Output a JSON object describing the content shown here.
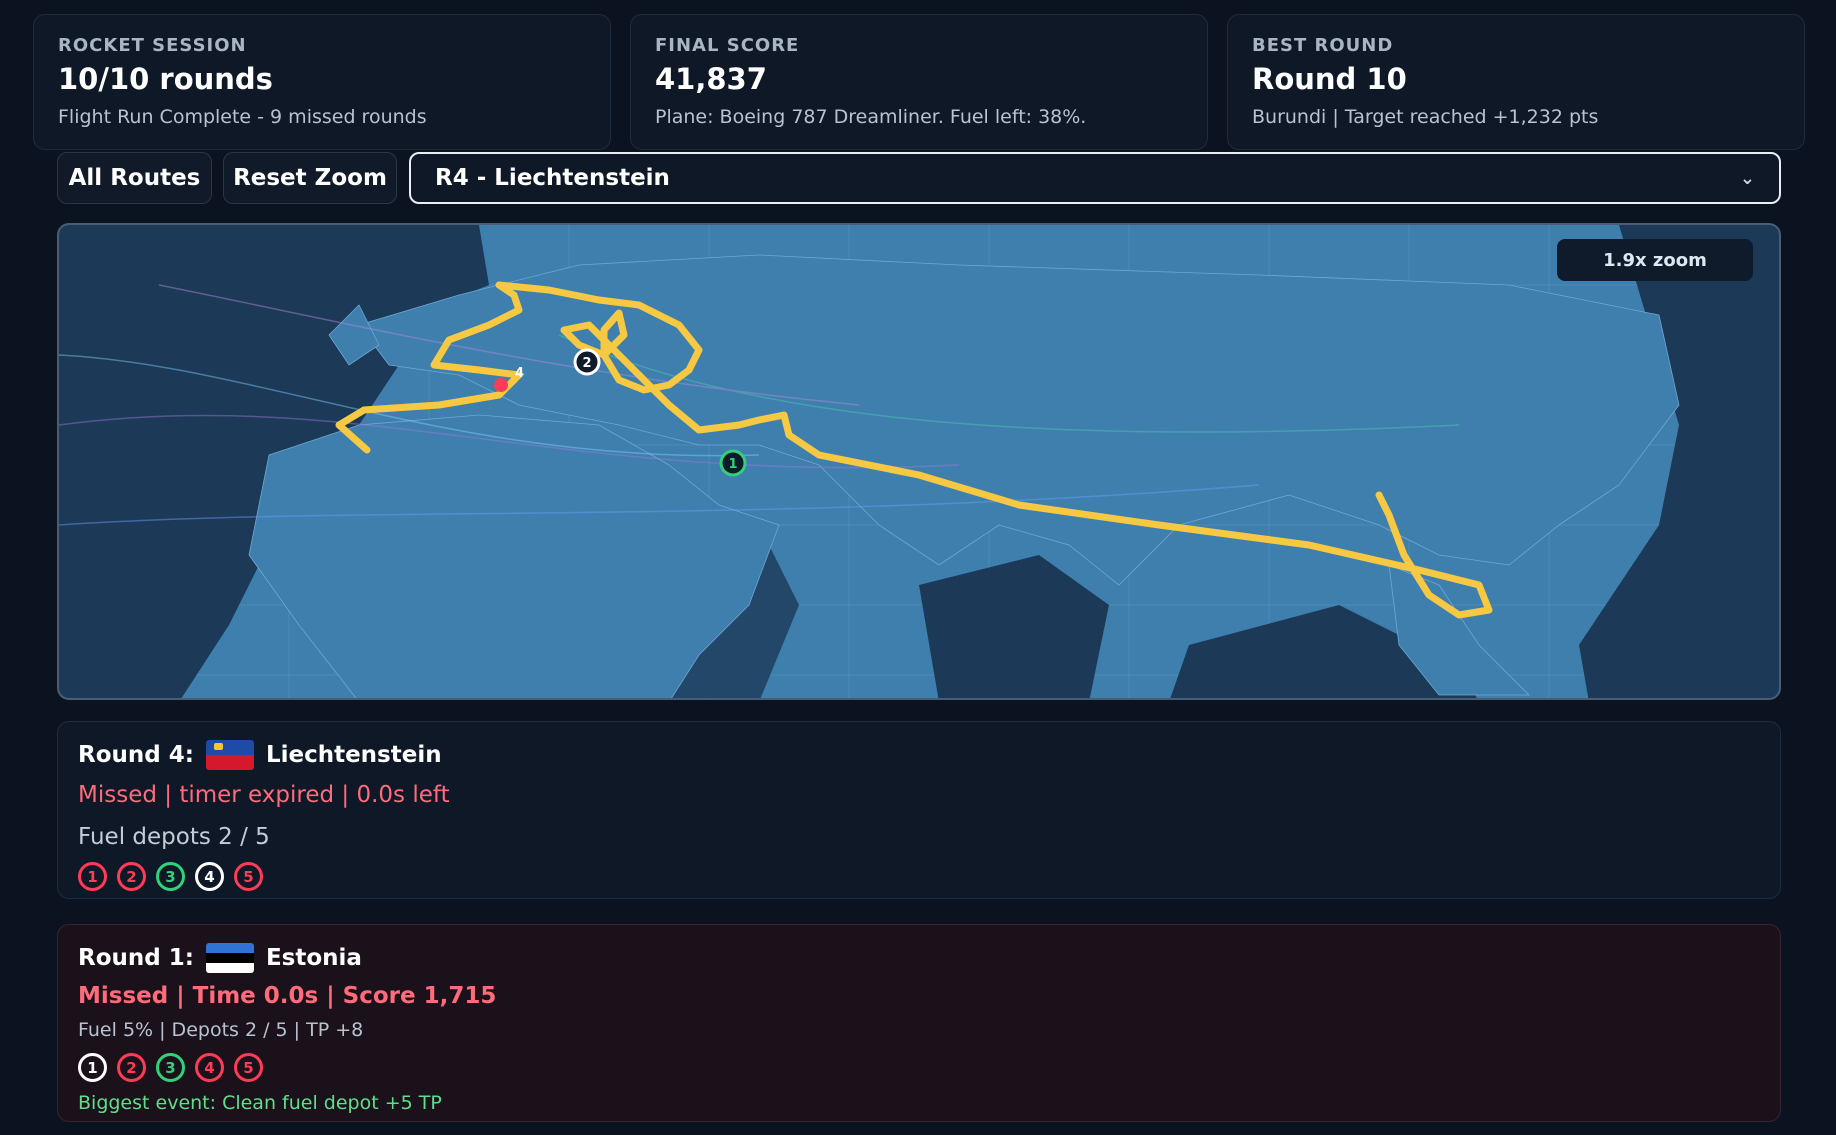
{
  "stats": [
    {
      "key": "ROCKET SESSION",
      "value": "10/10 rounds",
      "sub": "Flight Run Complete - 9 missed rounds"
    },
    {
      "key": "FINAL SCORE",
      "value": "41,837",
      "sub": "Plane: Boeing 787 Dreamliner. Fuel left: 38%."
    },
    {
      "key": "BEST ROUND",
      "value": "Round 10",
      "sub": "Burundi | Target reached +1,232 pts"
    }
  ],
  "toolbar": {
    "all_routes": "All Routes",
    "reset_zoom": "Reset Zoom",
    "round_select": "R4 - Liechtenstein"
  },
  "map": {
    "zoom_label": "1.9x zoom",
    "markers": [
      {
        "label": "1",
        "color": "#33d07a"
      },
      {
        "label": "2",
        "color": "#ffffff"
      },
      {
        "label": "4",
        "color": "#ff3b55"
      }
    ],
    "route_color": "#f7c842"
  },
  "round_current": {
    "title": "Round 4:",
    "country": "Liechtenstein",
    "flag": [
      "#1e4aa8",
      "#d6182c"
    ],
    "status": "Missed | timer expired | 0.0s left",
    "fuel": "Fuel depots 2 / 5",
    "depots": [
      {
        "n": "1",
        "state": "red"
      },
      {
        "n": "2",
        "state": "red"
      },
      {
        "n": "3",
        "state": "green"
      },
      {
        "n": "4",
        "state": "white"
      },
      {
        "n": "5",
        "state": "red"
      }
    ]
  },
  "round_first": {
    "title": "Round 1:",
    "country": "Estonia",
    "flag": [
      "#2f73d6",
      "#000000",
      "#ffffff"
    ],
    "status": "Missed | Time 0.0s | Score 1,715",
    "detail": "Fuel 5% | Depots 2 / 5 | TP +8",
    "depots": [
      {
        "n": "1",
        "state": "white"
      },
      {
        "n": "2",
        "state": "red"
      },
      {
        "n": "3",
        "state": "green"
      },
      {
        "n": "4",
        "state": "red"
      },
      {
        "n": "5",
        "state": "red"
      }
    ],
    "event": "Biggest event: Clean fuel depot +5 TP"
  }
}
